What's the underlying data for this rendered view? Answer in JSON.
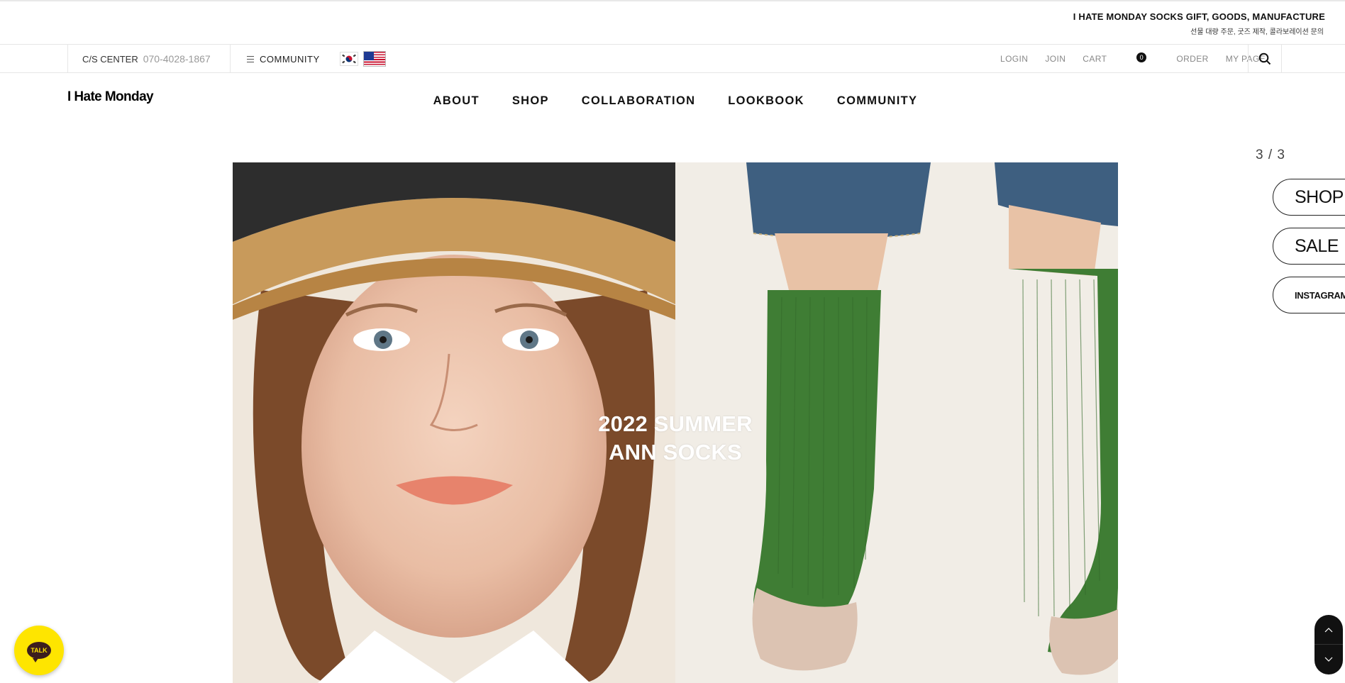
{
  "promo": {
    "title": "I HATE MONDAY SOCKS GIFT, GOODS, MANUFACTURE",
    "subtitle": "선물 대량 주문, 굿즈 제작, 콜라보레이션 문의"
  },
  "utility": {
    "cs_label": "C/S CENTER",
    "cs_phone": "070-4028-1867",
    "community": "COMMUNITY",
    "login": "LOGIN",
    "join": "JOIN",
    "cart": "CART",
    "cart_count": "0",
    "order": "ORDER",
    "mypage": "MY PAGE"
  },
  "header": {
    "logo": "I Hate Monday",
    "nav": [
      "ABOUT",
      "SHOP",
      "COLLABORATION",
      "LOOKBOOK",
      "COMMUNITY"
    ]
  },
  "hero": {
    "line1": "2022 SUMMER",
    "line2": "ANN SOCKS"
  },
  "side": {
    "counter": "3 / 3",
    "shop": "SHOP",
    "sale": "SALE",
    "instagram": "INSTAGRAM"
  },
  "talk": {
    "label": "TALK"
  },
  "icons": {
    "search": "search-icon",
    "menu": "hamburger-icon",
    "flag_kr": "korea-flag-icon",
    "flag_us": "usa-flag-icon",
    "scroll_up": "chevron-up-icon",
    "scroll_down": "chevron-down-icon"
  },
  "colors": {
    "kakao_yellow": "#fee500",
    "sock_green": "#3f7d34",
    "denim": "#3e5f80"
  }
}
